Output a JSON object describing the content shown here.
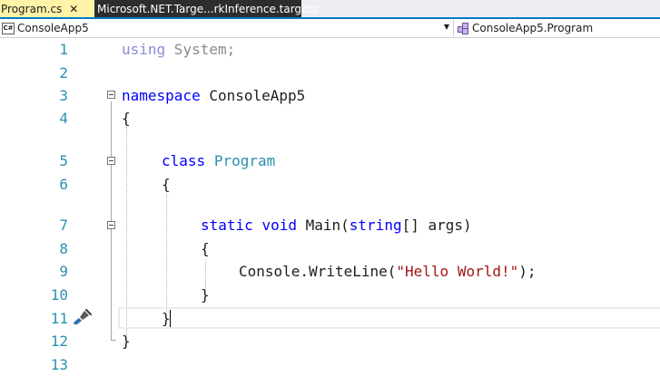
{
  "tabs": [
    {
      "label": "Program.cs",
      "close": "✕",
      "active": true
    },
    {
      "label": "Microsoft.NET.Targe...rkInference.targets",
      "active": false
    }
  ],
  "navbar": {
    "project_icon": "C#",
    "project": "ConsoleApp5",
    "class_path": "ConsoleApp5.Program"
  },
  "editor": {
    "line_numbers": [
      "1",
      "2",
      "3",
      "4",
      "5",
      "6",
      "7",
      "8",
      "9",
      "10",
      "11",
      "12",
      "13"
    ],
    "lines": {
      "l1_kw": "using",
      "l1_rest": " System;",
      "l3_kw": "namespace",
      "l3_rest": " ConsoleApp5",
      "l4": "{",
      "l5_kw": "class",
      "l5_type": "Program",
      "l6": "{",
      "l7_kw1": "static",
      "l7_kw2": "void",
      "l7_name": "Main(",
      "l7_kw3": "string",
      "l7_rest": "[] args)",
      "l8": "{",
      "l9_a": "Console.WriteLine(",
      "l9_str": "\"Hello World!\"",
      "l9_b": ");",
      "l10": "}",
      "l11": "}",
      "l12": "}"
    },
    "icons": {
      "quick_action": "paintbrush-icon"
    }
  }
}
